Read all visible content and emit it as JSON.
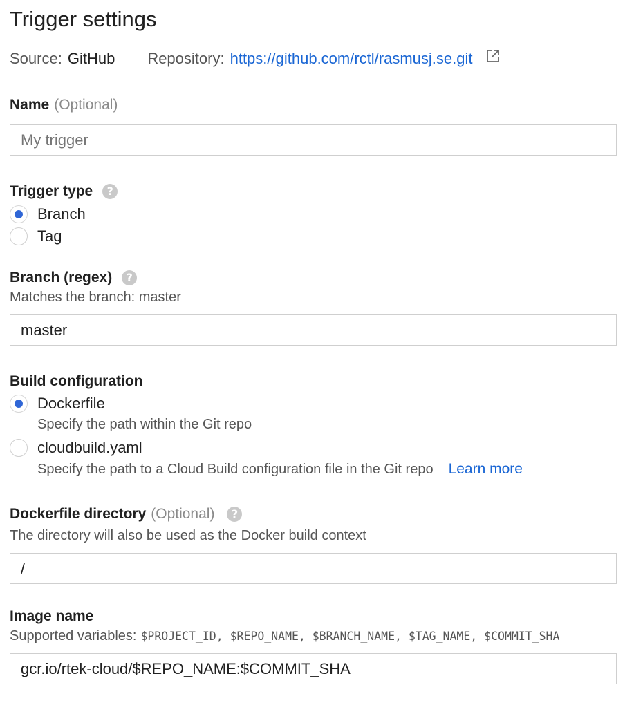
{
  "title": "Trigger settings",
  "source": {
    "label": "Source:",
    "value": "GitHub",
    "repo_label": "Repository:",
    "repo_url": "https://github.com/rctl/rasmusj.se.git",
    "open_icon": "open-in-new-icon"
  },
  "name_field": {
    "label": "Name",
    "optional": "(Optional)",
    "placeholder": "My trigger",
    "value": ""
  },
  "trigger_type": {
    "label": "Trigger type",
    "help_icon": "help-icon",
    "options": [
      {
        "label": "Branch",
        "selected": true
      },
      {
        "label": "Tag",
        "selected": false
      }
    ]
  },
  "branch": {
    "label": "Branch (regex)",
    "help_icon": "help-icon",
    "matches": "Matches the branch: master",
    "value": "master"
  },
  "build_config": {
    "label": "Build configuration",
    "options": [
      {
        "label": "Dockerfile",
        "desc": "Specify the path within the Git repo",
        "selected": true
      },
      {
        "label": "cloudbuild.yaml",
        "desc": "Specify the path to a Cloud Build configuration file in the Git repo",
        "selected": false
      }
    ],
    "learn_more": "Learn more"
  },
  "dockerfile_dir": {
    "label": "Dockerfile directory",
    "optional": "(Optional)",
    "help_icon": "help-icon",
    "desc": "The directory will also be used as the Docker build context",
    "value": "/"
  },
  "image_name": {
    "label": "Image name",
    "vars_label": "Supported variables:",
    "vars": "$PROJECT_ID, $REPO_NAME, $BRANCH_NAME, $TAG_NAME, $COMMIT_SHA",
    "value": "gcr.io/rtek-cloud/$REPO_NAME:$COMMIT_SHA"
  },
  "colors": {
    "accent": "#2f66d6",
    "link": "#1a66d4",
    "border": "#cfcfcf",
    "help_icon_bg": "#c9c9c9"
  }
}
